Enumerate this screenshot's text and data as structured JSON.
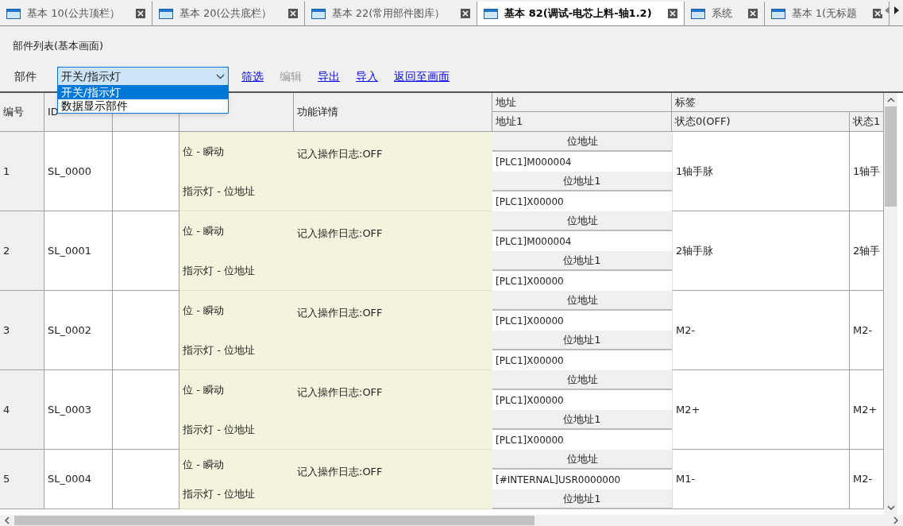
{
  "tabs": [
    {
      "label": "基本 10(公共顶栏）",
      "selected": false
    },
    {
      "label": "基本 20(公共底栏）",
      "selected": false
    },
    {
      "label": "基本 22(常用部件图库）",
      "selected": false
    },
    {
      "label": "基本 82(调试-电芯上料-轴1.2)",
      "selected": true
    },
    {
      "label": "系统",
      "selected": false
    },
    {
      "label": "基本 1(无标题",
      "selected": false
    }
  ],
  "title": "部件列表(基本画面)",
  "toolbar": {
    "label": "部件",
    "select": {
      "value": "开关/指示灯",
      "expanded": true,
      "options": [
        {
          "label": "开关/指示灯",
          "selected": true
        },
        {
          "label": "数据显示部件",
          "selected": false
        }
      ]
    },
    "links": [
      {
        "label": "筛选",
        "disabled": false
      },
      {
        "label": "编辑",
        "disabled": true
      },
      {
        "label": "导出",
        "disabled": false
      },
      {
        "label": "导入",
        "disabled": false
      },
      {
        "label": "返回至画面",
        "disabled": false
      }
    ]
  },
  "table": {
    "columns": [
      "编号",
      "ID",
      null,
      null,
      "功能详情"
    ],
    "group_address": "地址",
    "group_label": "标签",
    "address_column": "地址1",
    "label_columns": [
      "状态0(OFF)",
      "状态1"
    ],
    "rows": [
      {
        "no": "1",
        "id": "SL_0000",
        "functions": [
          "位 - 瞬动",
          "指示灯 - 位地址"
        ],
        "detail": "记入操作日志:OFF",
        "addresses": [
          {
            "label": "位地址",
            "value": "[PLC1]M000004"
          },
          {
            "label": "位地址1",
            "value": "[PLC1]X00000"
          }
        ],
        "state0": "1轴手脉",
        "state1": "1轴手"
      },
      {
        "no": "2",
        "id": "SL_0001",
        "functions": [
          "位 - 瞬动",
          "指示灯 - 位地址"
        ],
        "detail": "记入操作日志:OFF",
        "addresses": [
          {
            "label": "位地址",
            "value": "[PLC1]M000004"
          },
          {
            "label": "位地址1",
            "value": "[PLC1]X00000"
          }
        ],
        "state0": "2轴手脉",
        "state1": "2轴手"
      },
      {
        "no": "3",
        "id": "SL_0002",
        "functions": [
          "位 - 瞬动",
          "指示灯 - 位地址"
        ],
        "detail": "记入操作日志:OFF",
        "addresses": [
          {
            "label": "位地址",
            "value": "[PLC1]X00000"
          },
          {
            "label": "位地址1",
            "value": "[PLC1]X00000"
          }
        ],
        "state0": "M2-",
        "state1": "M2-"
      },
      {
        "no": "4",
        "id": "SL_0003",
        "functions": [
          "位 - 瞬动",
          "指示灯 - 位地址"
        ],
        "detail": "记入操作日志:OFF",
        "addresses": [
          {
            "label": "位地址",
            "value": "[PLC1]X00000"
          },
          {
            "label": "位地址1",
            "value": "[PLC1]X00000"
          }
        ],
        "state0": "M2+",
        "state1": "M2+"
      },
      {
        "no": "5",
        "id": "SL_0004",
        "functions": [
          "位 - 瞬动",
          "指示灯 - 位地址"
        ],
        "detail": "记入操作日志:OFF",
        "addresses": [
          {
            "label": "位地址",
            "value": "[#INTERNAL]USR0000000"
          },
          {
            "label": "位地址1"
          }
        ],
        "state0": "M1-",
        "state1": "M2-"
      }
    ]
  }
}
